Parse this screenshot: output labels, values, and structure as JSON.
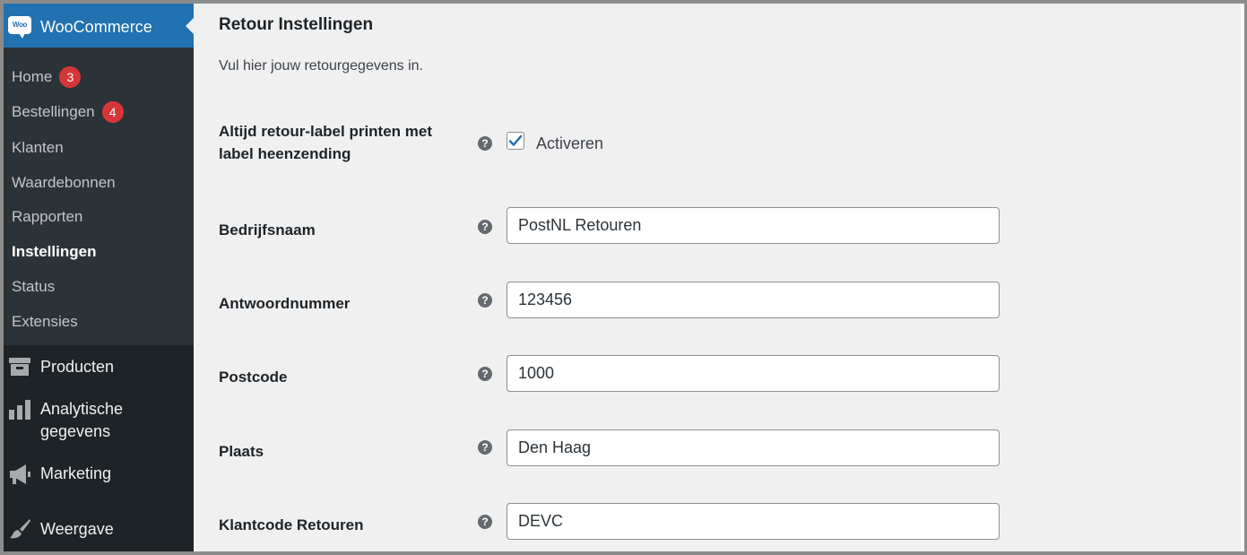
{
  "sidebar": {
    "brand": {
      "logo_text": "Woo",
      "title": "WooCommerce"
    },
    "submenu": [
      {
        "label": "Home",
        "badge": "3"
      },
      {
        "label": "Bestellingen",
        "badge": "4"
      },
      {
        "label": "Klanten"
      },
      {
        "label": "Waardebonnen"
      },
      {
        "label": "Rapporten"
      },
      {
        "label": "Instellingen",
        "active": true
      },
      {
        "label": "Status"
      },
      {
        "label": "Extensies"
      }
    ],
    "menu": [
      {
        "label": "Producten",
        "icon": "archive-icon"
      },
      {
        "label_line1": "Analytische",
        "label_line2": "gegevens",
        "icon": "bar-chart-icon"
      },
      {
        "label": "Marketing",
        "icon": "megaphone-icon"
      },
      {
        "label": "Weergave",
        "icon": "paintbrush-icon"
      }
    ]
  },
  "main": {
    "title": "Retour Instellingen",
    "description": "Vul hier jouw retourgegevens in.",
    "checkbox_row": {
      "label_line1": "Altijd retour-label printen met",
      "label_line2": "label heenzending",
      "checkbox_label": "Activeren",
      "checked": true
    },
    "fields": [
      {
        "label": "Bedrijfsnaam",
        "value": "PostNL Retouren"
      },
      {
        "label": "Antwoordnummer",
        "value": "123456"
      },
      {
        "label": "Postcode",
        "value": "1000"
      },
      {
        "label": "Plaats",
        "value": "Den Haag"
      },
      {
        "label": "Klantcode Retouren",
        "value": "DEVC"
      }
    ],
    "help_glyph": "?"
  },
  "colors": {
    "accent": "#2271b1",
    "sidebar": "#1d2327",
    "submenu": "#2c3338",
    "badge": "#d63638",
    "background": "#f0f0f1"
  }
}
